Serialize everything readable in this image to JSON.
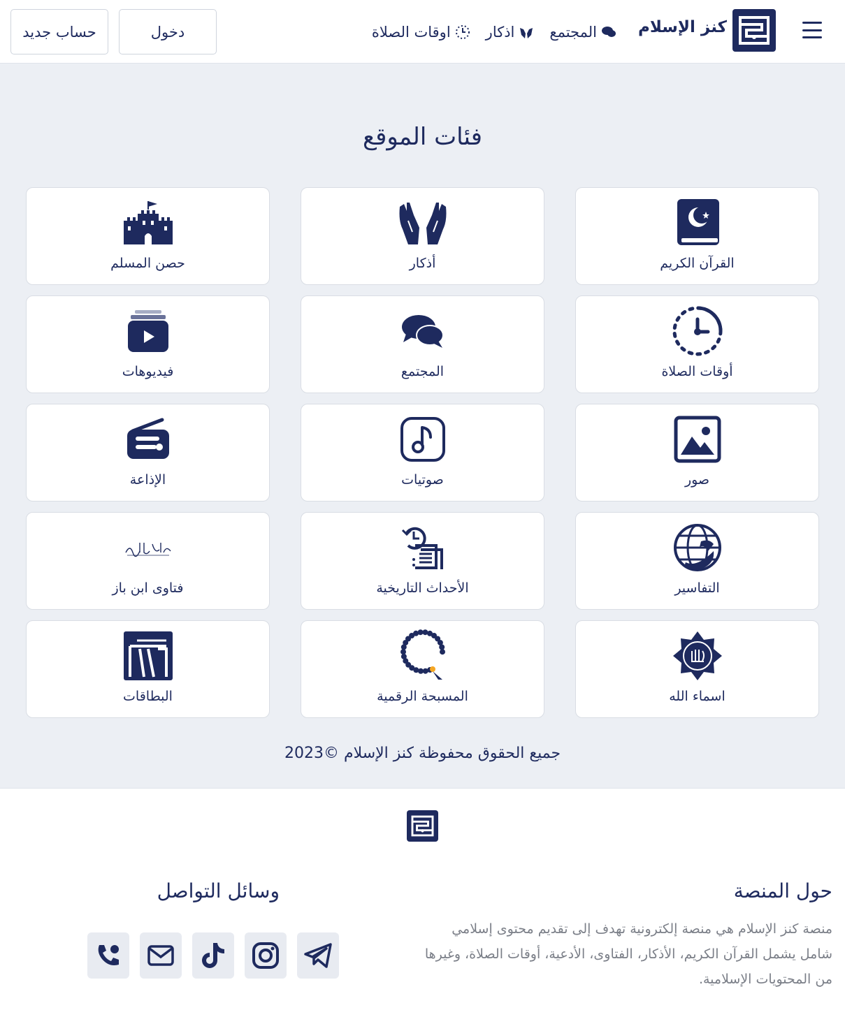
{
  "header": {
    "logo_text": "كنز الإسلام",
    "nav": [
      {
        "label": "المجتمع",
        "icon": "chat-icon"
      },
      {
        "label": "اذكار",
        "icon": "praying-hands-icon"
      },
      {
        "label": "اوقات الصلاة",
        "icon": "clock-icon"
      }
    ],
    "login_label": "دخول",
    "register_label": "حساب جديد"
  },
  "main": {
    "title": "فئات الموقع",
    "categories": [
      {
        "label": "القرآن الكريم",
        "icon": "quran-book-icon"
      },
      {
        "label": "أذكار",
        "icon": "praying-hands-icon"
      },
      {
        "label": "حصن المسلم",
        "icon": "castle-icon"
      },
      {
        "label": "أوقات الصلاة",
        "icon": "prayer-clock-icon"
      },
      {
        "label": "المجتمع",
        "icon": "chat-bubbles-icon"
      },
      {
        "label": "فيديوهات",
        "icon": "video-library-icon"
      },
      {
        "label": "صور",
        "icon": "image-icon"
      },
      {
        "label": "صوتيات",
        "icon": "music-note-icon"
      },
      {
        "label": "الإذاعة",
        "icon": "radio-icon"
      },
      {
        "label": "التفاسير",
        "icon": "tafsir-globe-icon"
      },
      {
        "label": "الأحداث التاريخية",
        "icon": "history-list-icon"
      },
      {
        "label": "فتاوى ابن باز",
        "icon": "ibn-baz-calligraphy-icon"
      },
      {
        "label": "اسماء الله",
        "icon": "allah-names-star-icon"
      },
      {
        "label": "المسبحة الرقمية",
        "icon": "prayer-beads-icon"
      },
      {
        "label": "البطاقات",
        "icon": "cards-icon"
      }
    ],
    "copyright": "جميع الحقوق محفوظة كنز الإسلام ©2023"
  },
  "footer": {
    "about_title": "حول المنصة",
    "about_text": "منصة كنز الإسلام هي منصة إلكترونية تهدف إلى تقديم محتوى إسلامي شامل يشمل القرآن الكريم، الأذكار، الفتاوى، الأدعية، أوقات الصلاة، وغيرها من المحتويات الإسلامية.",
    "social_title": "وسائل التواصل",
    "social": [
      "phone-icon",
      "email-icon",
      "tiktok-icon",
      "instagram-icon",
      "telegram-icon"
    ]
  },
  "colors": {
    "primary": "#1e2a5e",
    "accent": "#f5a623",
    "background": "#eceff4"
  }
}
